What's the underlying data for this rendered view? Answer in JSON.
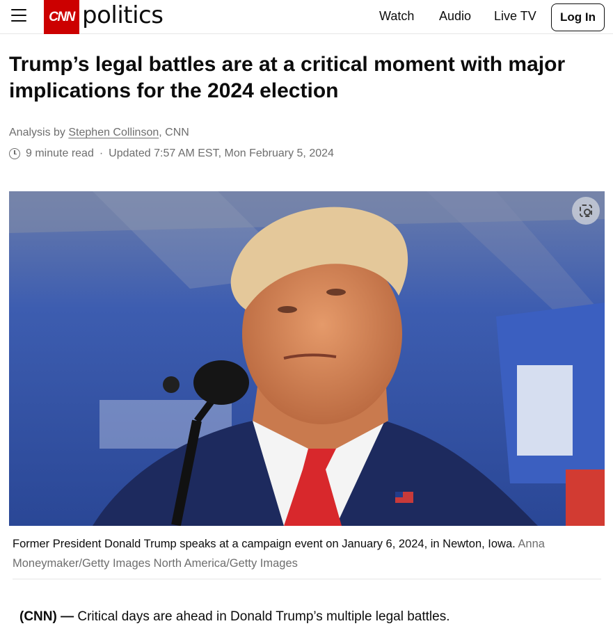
{
  "header": {
    "logo_text": "CNN",
    "section": "politics",
    "nav": [
      "Watch",
      "Audio",
      "Live TV"
    ],
    "login_label": "Log In"
  },
  "article": {
    "headline": "Trump’s legal battles are at a critical moment with major implications for the 2024 election",
    "byline_prefix": "Analysis by",
    "author": "Stephen Collinson",
    "byline_suffix": ", CNN",
    "read_time": "9 minute read",
    "separator": "·",
    "updated": "Updated 7:57 AM EST, Mon February 5, 2024",
    "caption": "Former President Donald Trump speaks at a campaign event on January 6, 2024, in Newton, Iowa.",
    "credit": "Anna Moneymaker/Getty Images North America/Getty Images",
    "lead_source": "(CNN) —",
    "lead_text": " Critical days are ahead in Donald Trump’s multiple legal battles."
  },
  "colors": {
    "brand_red": "#cc0000",
    "text": "#0c0c0c",
    "muted": "#6e6e6e",
    "hero_blue": "#2e4e9c"
  },
  "icons": {
    "menu": "hamburger-icon",
    "clock": "clock-icon",
    "lens": "image-search-icon"
  }
}
